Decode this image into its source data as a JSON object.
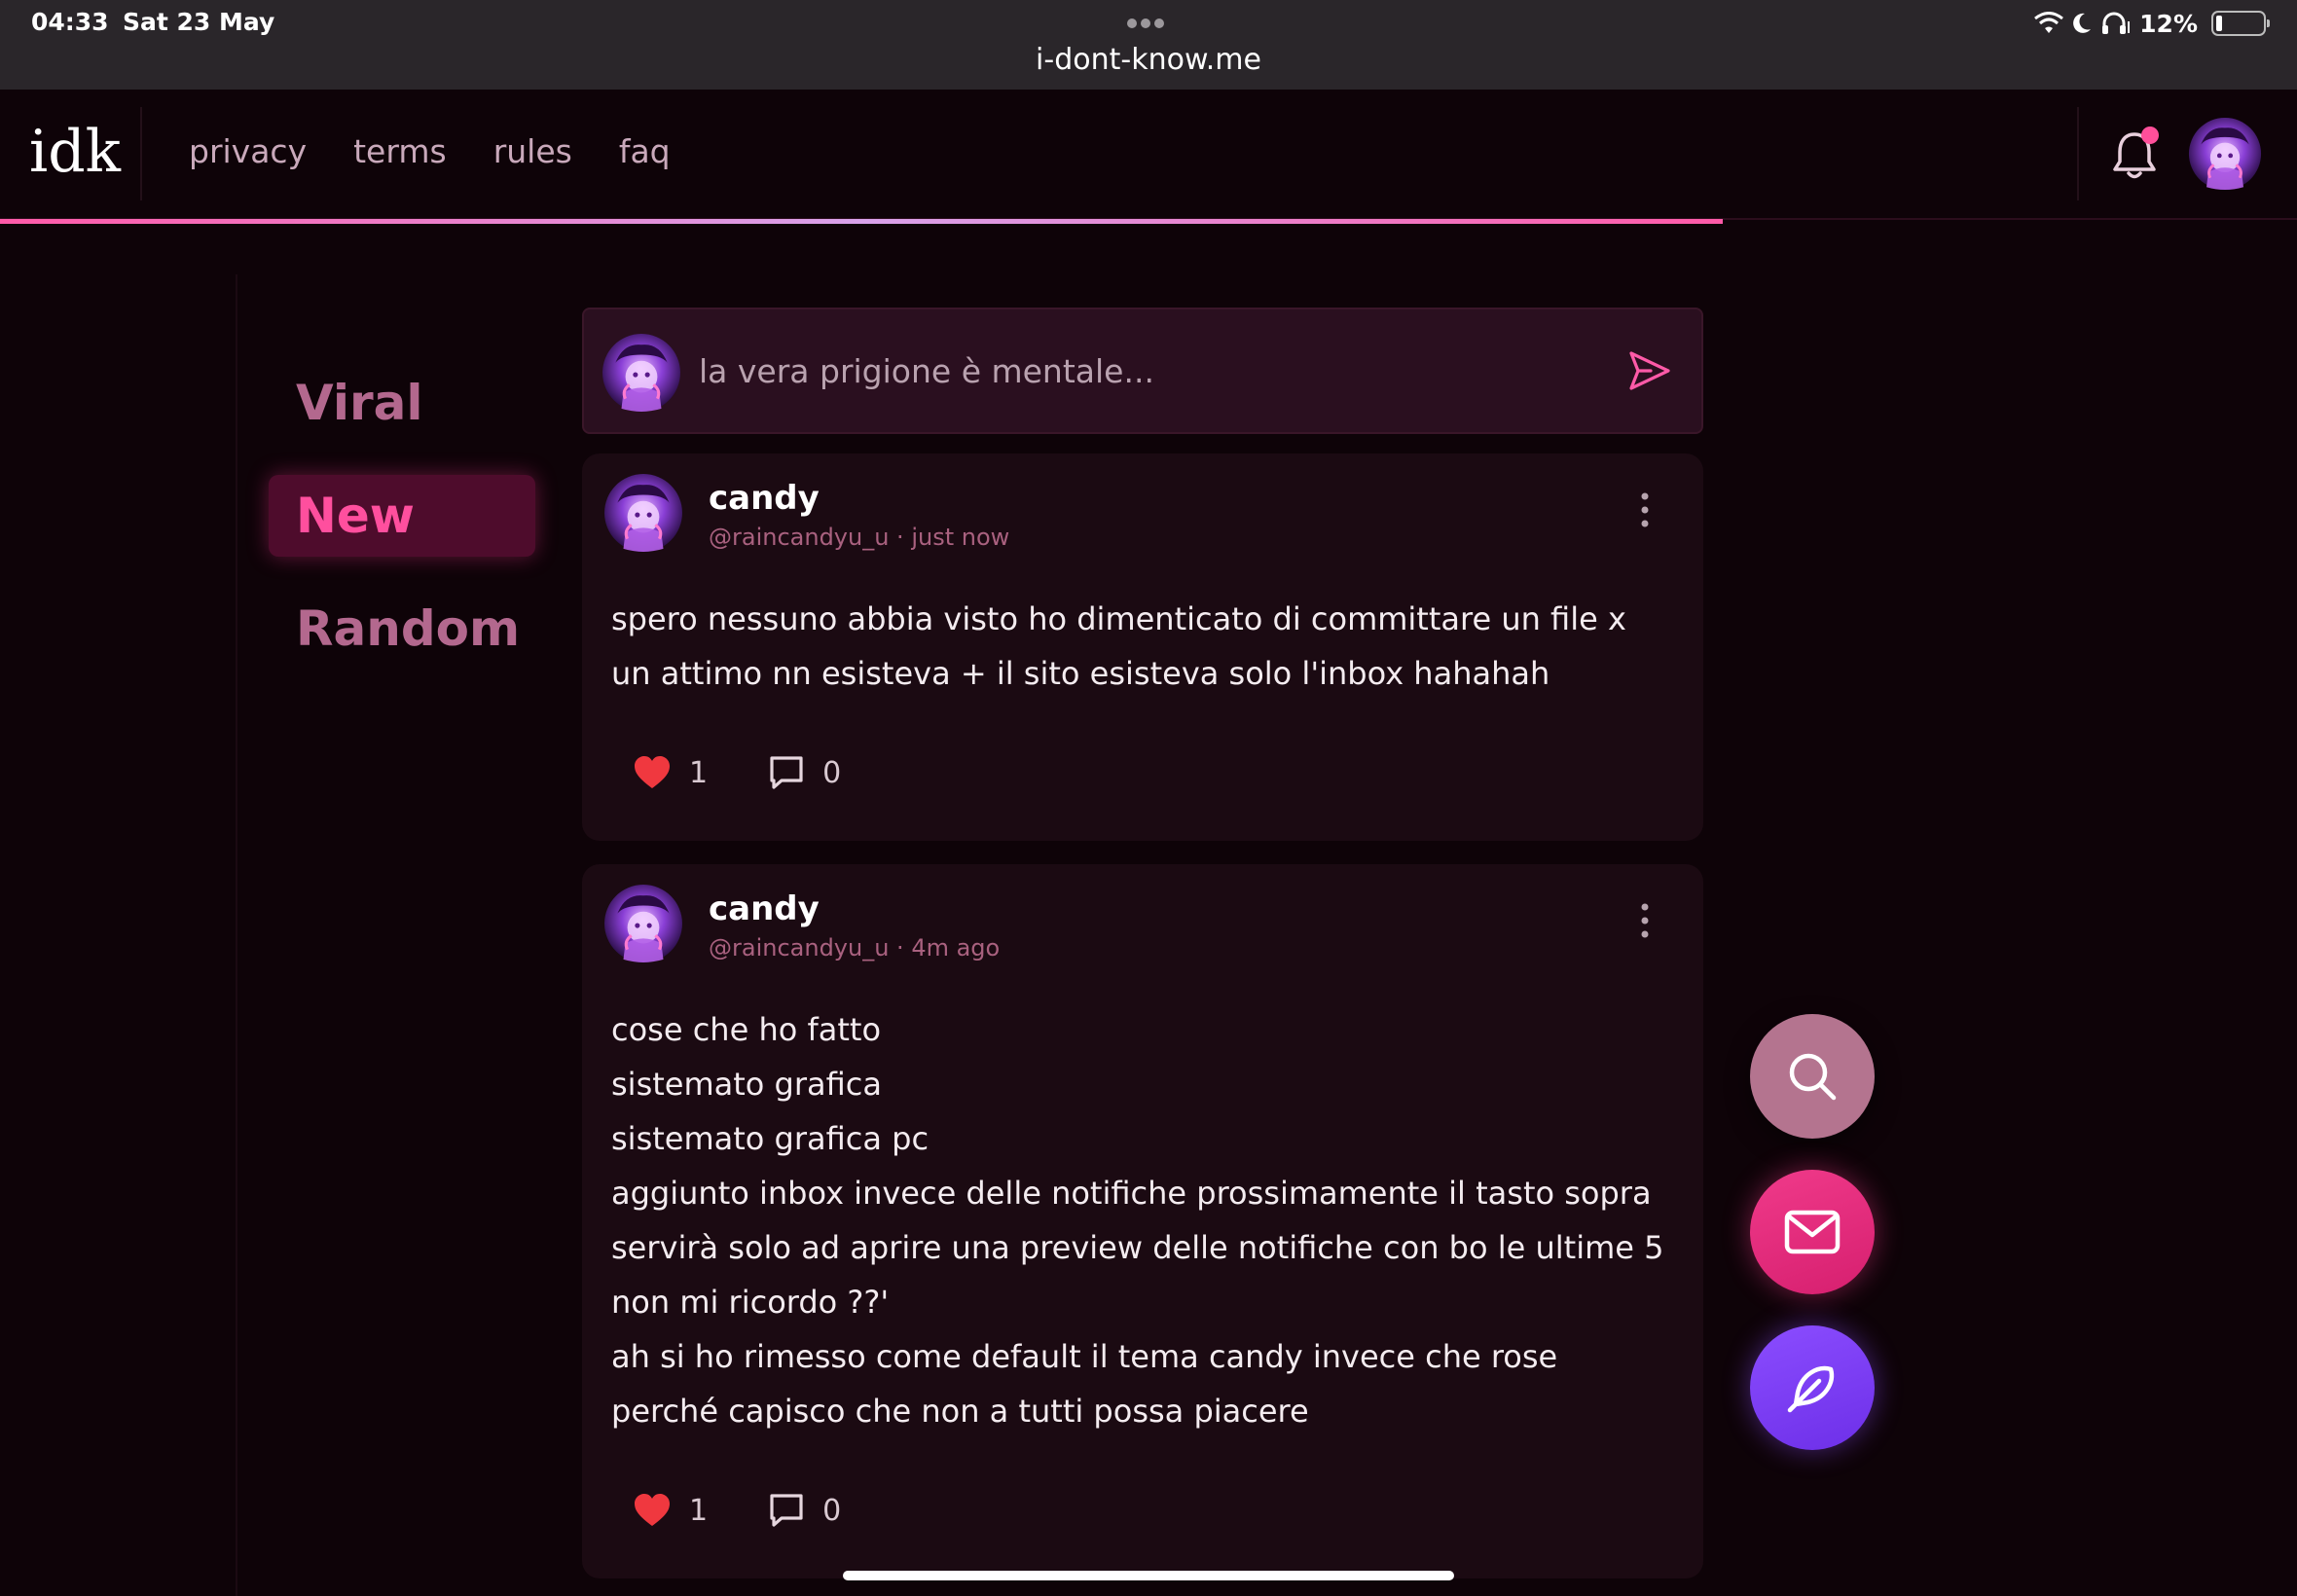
{
  "status_bar": {
    "time": "04:33",
    "date": "Sat 23 May",
    "url": "i-dont-know.me",
    "battery_pct": "12%",
    "battery_level": 0.12
  },
  "header": {
    "logo": "idk",
    "nav": [
      "privacy",
      "terms",
      "rules",
      "faq"
    ],
    "has_notification": true
  },
  "sidebar": {
    "items": [
      {
        "label": "Viral",
        "active": false
      },
      {
        "label": "New",
        "active": true
      },
      {
        "label": "Random",
        "active": false
      }
    ]
  },
  "composer": {
    "placeholder": "la vera prigione è mentale..."
  },
  "posts": [
    {
      "name": "candy",
      "handle": "@raincandyu_u",
      "time": "just now",
      "meta": "@raincandyu_u · just now",
      "lines": [
        "spero nessuno abbia visto ho dimenticato di committare un file x",
        "un attimo nn esisteva + il sito esisteva solo l'inbox hahahah"
      ],
      "likes": "1",
      "comments": "0"
    },
    {
      "name": "candy",
      "handle": "@raincandyu_u",
      "time": "4m ago",
      "meta": "@raincandyu_u · 4m ago",
      "lines": [
        "cose che ho fatto",
        "sistemato grafica",
        "sistemato grafica pc",
        "aggiunto inbox invece delle notifiche prossimamente il tasto sopra",
        "servirà solo ad aprire una preview delle notifiche con bo le ultime 5",
        "non mi ricordo ??'",
        "ah si ho rimesso come default il tema candy invece che rose",
        "perché capisco che non a tutti possa piacere"
      ],
      "likes": "1",
      "comments": "0"
    }
  ],
  "fabs": [
    "search-icon",
    "mail-icon",
    "feather-icon"
  ],
  "colors": {
    "background": "#0e0308",
    "accent_pink": "#ff4f9e",
    "card": "#1b0a12",
    "purple": "#8b4dff"
  }
}
